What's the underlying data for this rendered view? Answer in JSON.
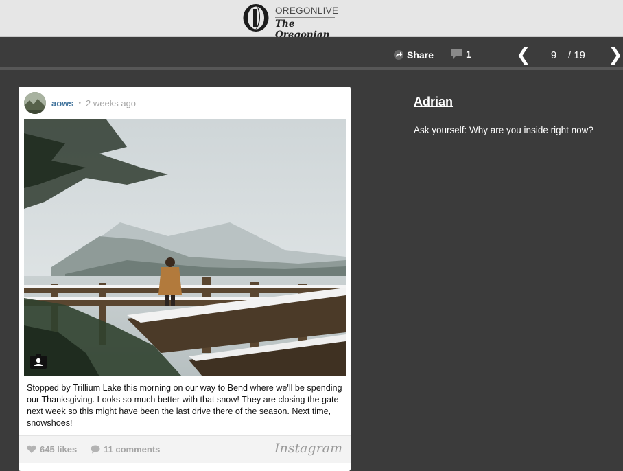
{
  "masthead": {
    "brand_top": "OREGONLIVE",
    "brand_bottom": "The Oregonian"
  },
  "toolbar": {
    "share_label": "Share",
    "comment_count": "1",
    "prev_glyph": "❮",
    "next_glyph": "❯",
    "current_slide": "9",
    "total_slides": "/ 19"
  },
  "post": {
    "username": "aows",
    "separator": "•",
    "time_ago": "2 weeks ago",
    "caption": "Stopped by Trillium Lake this morning on our way to Bend where we'll be spending our Thanksgiving. Looks so much better with that snow! They are closing the gate next week so this might have been the last drive there of the season. Next time, snowshoes!",
    "likes": "645 likes",
    "comments": "11 comments",
    "platform": "Instagram"
  },
  "slide": {
    "title": "Adrian",
    "description": "Ask yourself: Why are you inside right now?"
  },
  "colors": {
    "page_bg": "#3b3b3b",
    "masthead_bg": "#e6e6e6",
    "username_blue": "#3f729b",
    "muted_grey": "#a5a5a5"
  },
  "icons": {
    "logo": "oregonian-o-logo",
    "share": "share-arrow-icon",
    "comment": "speech-bubble-icon",
    "user_tag": "user-tag-icon",
    "like": "heart-icon",
    "comment_footer": "comment-bubble-icon"
  }
}
